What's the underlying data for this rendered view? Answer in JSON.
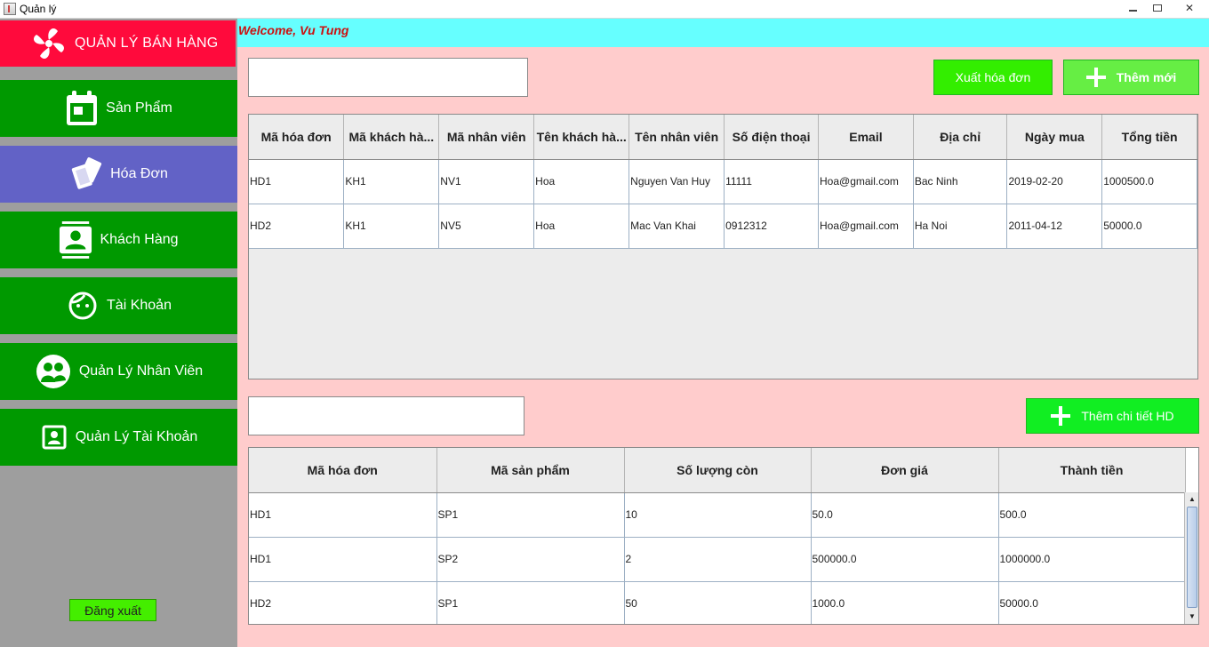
{
  "window": {
    "title": "Quản lý"
  },
  "sidebar": {
    "brand": "QUẢN LÝ BÁN HÀNG",
    "items": [
      {
        "label": "Sản Phẩm",
        "icon": "calendar-icon"
      },
      {
        "label": "Hóa Đơn",
        "icon": "cards-icon",
        "active": true
      },
      {
        "label": "Khách Hàng",
        "icon": "contact-card-icon"
      },
      {
        "label": "Tài Khoản",
        "icon": "face-icon"
      },
      {
        "label": "Quản Lý Nhân Viên",
        "icon": "group-icon"
      },
      {
        "label": "Quản Lý Tài Khoản",
        "icon": "account-box-icon"
      }
    ],
    "logout": "Đăng xuất"
  },
  "welcome": "Welcome, Vu Tung",
  "toolbar": {
    "export_label": "Xuất hóa đơn",
    "add_label": "Thêm mới",
    "add_detail_label": "Thêm chi tiết HD"
  },
  "colors": {
    "brand": "#ff0a3c",
    "nav": "#009900",
    "nav_active": "#6262c6",
    "welcome_bar": "#66ffff",
    "main_bg": "#ffcccc",
    "export_button": "#33ee00",
    "add_button": "#66ee44"
  },
  "invoice_table": {
    "columns": [
      "Mã hóa đơn",
      "Mã khách hà...",
      "Mã nhân viên",
      "Tên khách hà...",
      "Tên nhân viên",
      "Số điện thoại",
      "Email",
      "Địa chỉ",
      "Ngày mua",
      "Tổng tiền"
    ],
    "rows": [
      [
        "HD1",
        "KH1",
        "NV1",
        "Hoa",
        "Nguyen Van Huy",
        "11111",
        "Hoa@gmail.com",
        "Bac Ninh",
        "2019-02-20",
        "1000500.0"
      ],
      [
        "HD2",
        "KH1",
        "NV5",
        "Hoa",
        "Mac Van Khai",
        "0912312",
        "Hoa@gmail.com",
        "Ha Noi",
        "2011-04-12",
        "50000.0"
      ]
    ]
  },
  "detail_table": {
    "columns": [
      "Mã hóa đơn",
      "Mã sản phẩm",
      "Số lượng còn",
      "Đơn giá",
      "Thành tiền"
    ],
    "rows": [
      [
        "HD1",
        "SP1",
        "10",
        "50.0",
        "500.0"
      ],
      [
        "HD1",
        "SP2",
        "2",
        "500000.0",
        "1000000.0"
      ],
      [
        "HD2",
        "SP1",
        "50",
        "1000.0",
        "50000.0"
      ]
    ]
  }
}
